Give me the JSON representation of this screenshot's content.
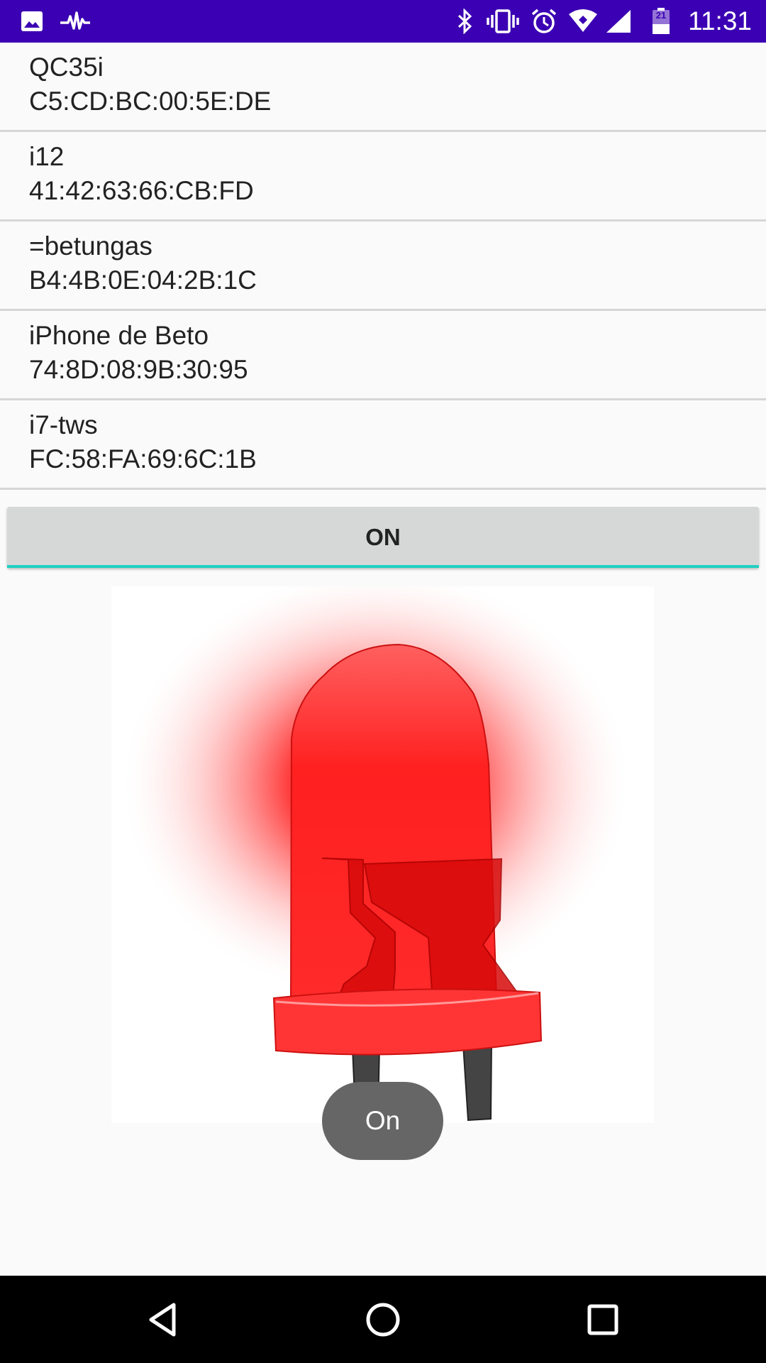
{
  "status_bar": {
    "time": "11:31",
    "battery_level": "21",
    "left_icons": [
      "image-icon",
      "activity-icon"
    ],
    "right_icons": [
      "bluetooth-icon",
      "vibrate-icon",
      "alarm-icon",
      "wifi-icon",
      "signal-icon",
      "battery-icon"
    ],
    "background_color": "#3b00b3"
  },
  "devices": [
    {
      "name": "QC35i",
      "mac": "C5:CD:BC:00:5E:DE"
    },
    {
      "name": "i12",
      "mac": "41:42:63:66:CB:FD"
    },
    {
      "name": "=betungas",
      "mac": "B4:4B:0E:04:2B:1C"
    },
    {
      "name": "iPhone de Beto",
      "mac": "74:8D:08:9B:30:95"
    },
    {
      "name": "i7-tws",
      "mac": "FC:58:FA:69:6C:1B"
    }
  ],
  "toggle_button": {
    "label": "ON",
    "accent_color": "#1fd0c1"
  },
  "led": {
    "color": "#ff2020",
    "state_icon": "red-led-icon"
  },
  "toast": {
    "text": "On"
  },
  "nav_bar": {
    "buttons": [
      "back-icon",
      "home-icon",
      "recents-icon"
    ]
  }
}
